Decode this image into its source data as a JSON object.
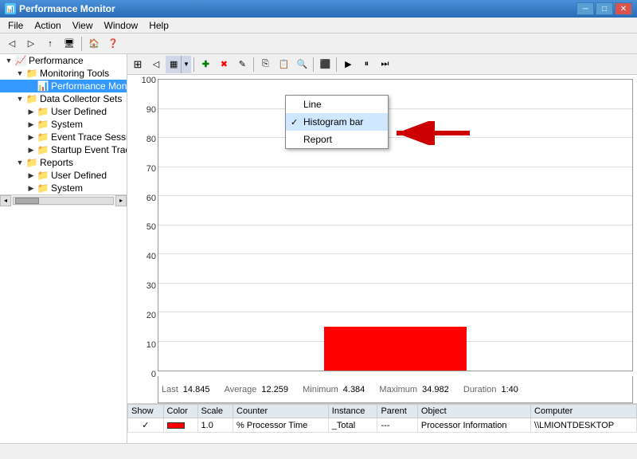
{
  "titleBar": {
    "title": "Performance Monitor",
    "icon": "📊",
    "controls": [
      "minimize",
      "maximize",
      "close"
    ]
  },
  "menuBar": {
    "items": [
      "File",
      "Action",
      "View",
      "Window",
      "Help"
    ]
  },
  "sidebar": {
    "tree": [
      {
        "id": "performance",
        "label": "Performance",
        "level": 0,
        "expanded": true,
        "icon": "perf"
      },
      {
        "id": "monitoring-tools",
        "label": "Monitoring Tools",
        "level": 1,
        "expanded": true,
        "icon": "folder"
      },
      {
        "id": "performance-monitor",
        "label": "Performance Monitor",
        "level": 2,
        "expanded": false,
        "selected": true,
        "icon": "chart"
      },
      {
        "id": "data-collector-sets",
        "label": "Data Collector Sets",
        "level": 1,
        "expanded": true,
        "icon": "folder"
      },
      {
        "id": "user-defined-1",
        "label": "User Defined",
        "level": 2,
        "icon": "folder"
      },
      {
        "id": "system",
        "label": "System",
        "level": 2,
        "icon": "folder"
      },
      {
        "id": "event-trace-sessions",
        "label": "Event Trace Sessions",
        "level": 2,
        "icon": "folder"
      },
      {
        "id": "startup-event-trace",
        "label": "Startup Event Trace Sess",
        "level": 2,
        "icon": "folder"
      },
      {
        "id": "reports",
        "label": "Reports",
        "level": 1,
        "expanded": true,
        "icon": "folder"
      },
      {
        "id": "user-defined-2",
        "label": "User Defined",
        "level": 2,
        "icon": "folder"
      },
      {
        "id": "system-2",
        "label": "System",
        "level": 2,
        "icon": "folder"
      }
    ]
  },
  "contentToolbar": {
    "buttons": [
      "view-back",
      "view-forward",
      "chart-view",
      "add",
      "delete",
      "highlight",
      "sep1",
      "copy",
      "paste",
      "properties",
      "sep2",
      "freeze",
      "sep3",
      "play",
      "pause",
      "step"
    ]
  },
  "chartTypeDropdown": {
    "label": "▦",
    "options": [
      {
        "id": "line",
        "label": "Line",
        "checked": false
      },
      {
        "id": "histogram-bar",
        "label": "Histogram bar",
        "checked": true
      },
      {
        "id": "report",
        "label": "Report",
        "checked": false
      }
    ]
  },
  "chart": {
    "yAxisLabels": [
      "0",
      "10",
      "20",
      "30",
      "40",
      "50",
      "60",
      "70",
      "80",
      "90",
      "100"
    ],
    "bar": {
      "x_pct": 35,
      "width_pct": 30,
      "height_pct": 15,
      "color": "#ff0000"
    }
  },
  "statsBar": {
    "last_label": "Last",
    "last_value": "14.845",
    "avg_label": "Average",
    "avg_value": "12.259",
    "min_label": "Minimum",
    "min_value": "4.384",
    "max_label": "Maximum",
    "max_value": "34.982",
    "dur_label": "Duration",
    "dur_value": "1:40"
  },
  "counterTable": {
    "headers": [
      "Show",
      "Color",
      "Scale",
      "Counter",
      "Instance",
      "Parent",
      "Object",
      "Computer"
    ],
    "rows": [
      {
        "show": "✓",
        "color": "red",
        "scale": "1.0",
        "counter": "% Processor Time",
        "instance": "_Total",
        "parent": "---",
        "object": "Processor Information",
        "computer": "\\\\LMIONTDESKTOP"
      }
    ]
  },
  "statusBar": {
    "text": ""
  }
}
